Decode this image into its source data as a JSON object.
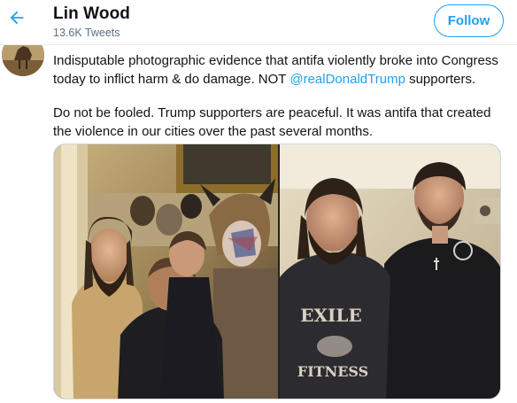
{
  "header": {
    "back_icon": "arrow-left-icon",
    "name": "Lin Wood",
    "tweet_count": "13.6K Tweets",
    "follow_label": "Follow"
  },
  "colors": {
    "accent": "#1da1f2",
    "text": "#0f1419",
    "secondary": "#5b7083"
  },
  "tweet": {
    "paragraph1_text": "Indisputable photographic evidence that antifa violently broke into Congress today to inflict harm & do damage. NOT ",
    "mention": "@realDonaldTrump",
    "paragraph1_suffix": " supporters.",
    "paragraph2": "Do not be fooled. Trump supporters are peaceful. It was antifa that created the violence in our cities over the past several months."
  },
  "media": {
    "photos": [
      {
        "name": "Capitol crowd photo"
      },
      {
        "name": "Two men posing photo",
        "shirt_text_top": "EXILE",
        "shirt_text_bottom": "FITNESS"
      }
    ]
  }
}
